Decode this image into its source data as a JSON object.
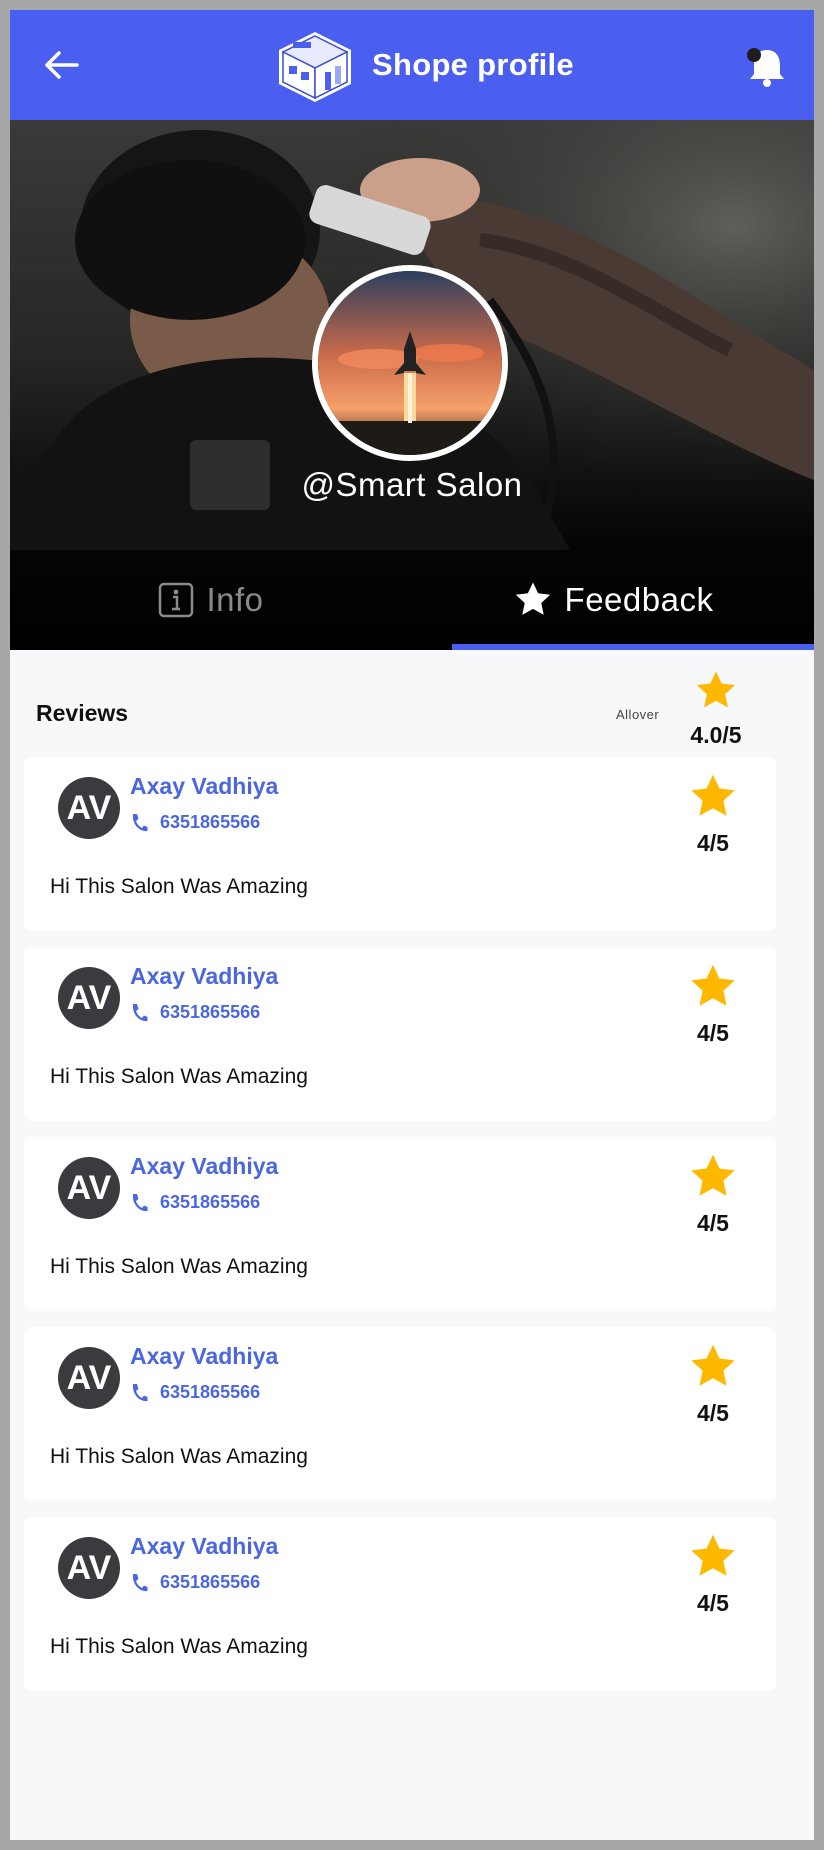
{
  "app_bar": {
    "title": "Shope profile",
    "back_icon": "arrow-left-icon",
    "logo_icon": "shop-building-icon",
    "bell_icon": "notification-bell-icon",
    "color": "#4a5ef0"
  },
  "profile": {
    "handle": "@Smart Salon",
    "avatar_icon": "rocket-launch-image"
  },
  "tabs": [
    {
      "label": "Info",
      "icon": "info-icon",
      "active": false
    },
    {
      "label": "Feedback",
      "icon": "star-icon",
      "active": true
    }
  ],
  "reviews": {
    "title": "Reviews",
    "allover_label": "Allover",
    "allover_rating": "4.0/5",
    "star_color": "#ffb800",
    "items": [
      {
        "initials": "AV",
        "name": "Axay Vadhiya",
        "phone": "6351865566",
        "score": "4/5",
        "text": "Hi This Salon Was Amazing"
      },
      {
        "initials": "AV",
        "name": "Axay Vadhiya",
        "phone": "6351865566",
        "score": "4/5",
        "text": "Hi This Salon Was Amazing"
      },
      {
        "initials": "AV",
        "name": "Axay Vadhiya",
        "phone": "6351865566",
        "score": "4/5",
        "text": "Hi This Salon Was Amazing"
      },
      {
        "initials": "AV",
        "name": "Axay Vadhiya",
        "phone": "6351865566",
        "score": "4/5",
        "text": "Hi This Salon Was Amazing"
      },
      {
        "initials": "AV",
        "name": "Axay Vadhiya",
        "phone": "6351865566",
        "score": "4/5",
        "text": "Hi This Salon Was Amazing"
      }
    ]
  }
}
